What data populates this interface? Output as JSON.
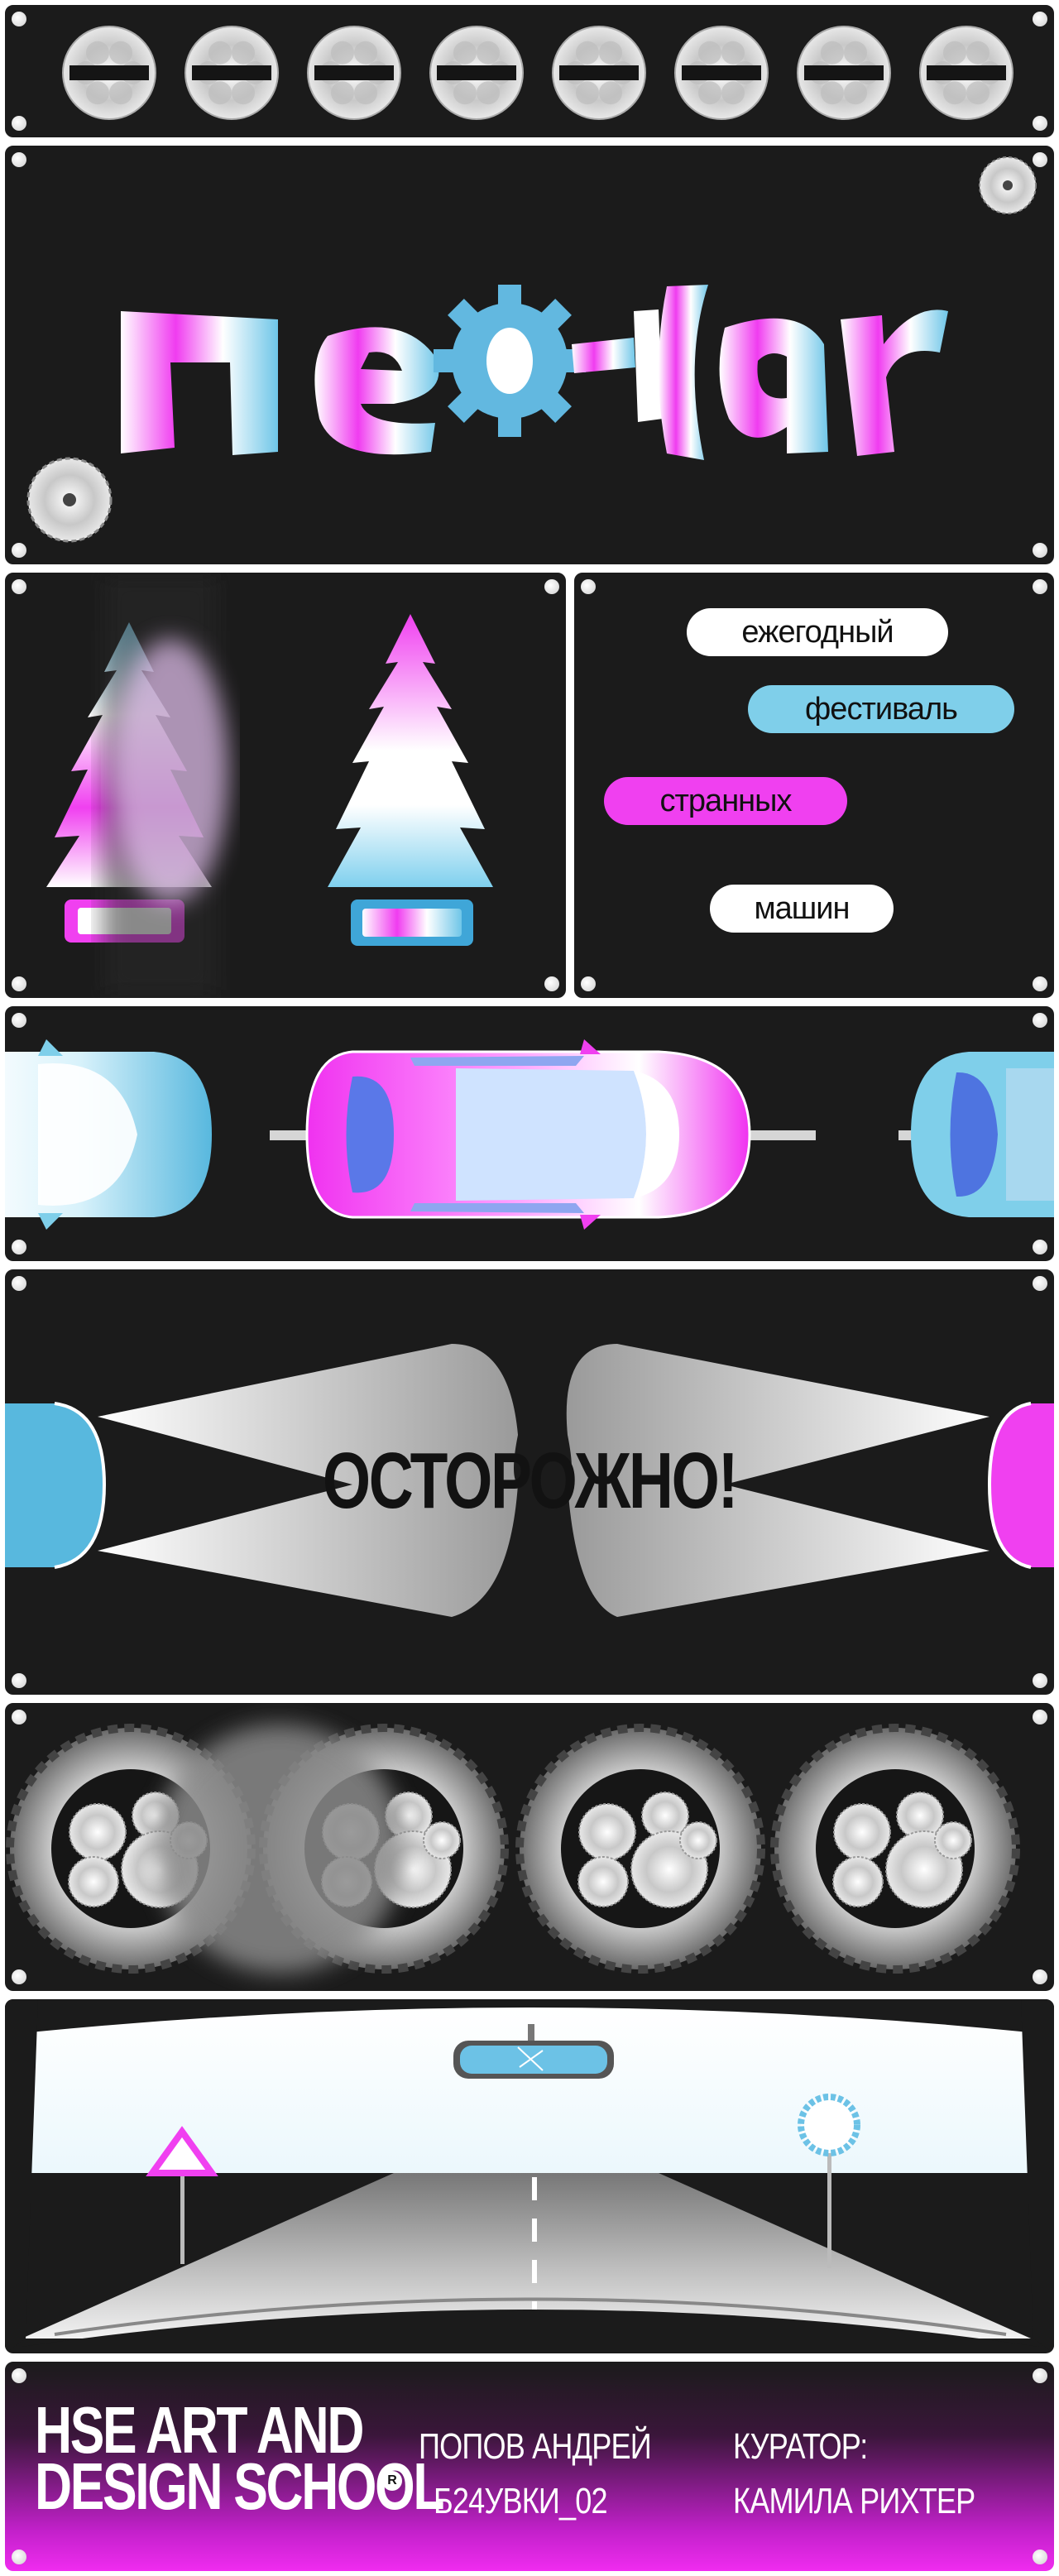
{
  "colors": {
    "pink": "#f02cf0",
    "blue": "#7fcfea",
    "bg": "#1b1b1b"
  },
  "header_disc_icons": [
    "disc-icon",
    "disc-icon",
    "disc-icon",
    "disc-icon",
    "disc-icon",
    "disc-icon",
    "disc-icon",
    "disc-icon"
  ],
  "title_logo": "neo-car",
  "tags": [
    "ежегодный",
    "фестиваль",
    "странных",
    "машин"
  ],
  "warning": "ОСТОРОЖНО!",
  "footer": {
    "school_line1": "HSE ART AND",
    "school_line2": "DESIGN SCHOOL",
    "author_name": "ПОПОВ АНДРЕЙ",
    "author_group": "Б24УВКИ_02",
    "curator_label": "КУРАТОР:",
    "curator_name": "КАМИЛА РИХТЕР"
  }
}
